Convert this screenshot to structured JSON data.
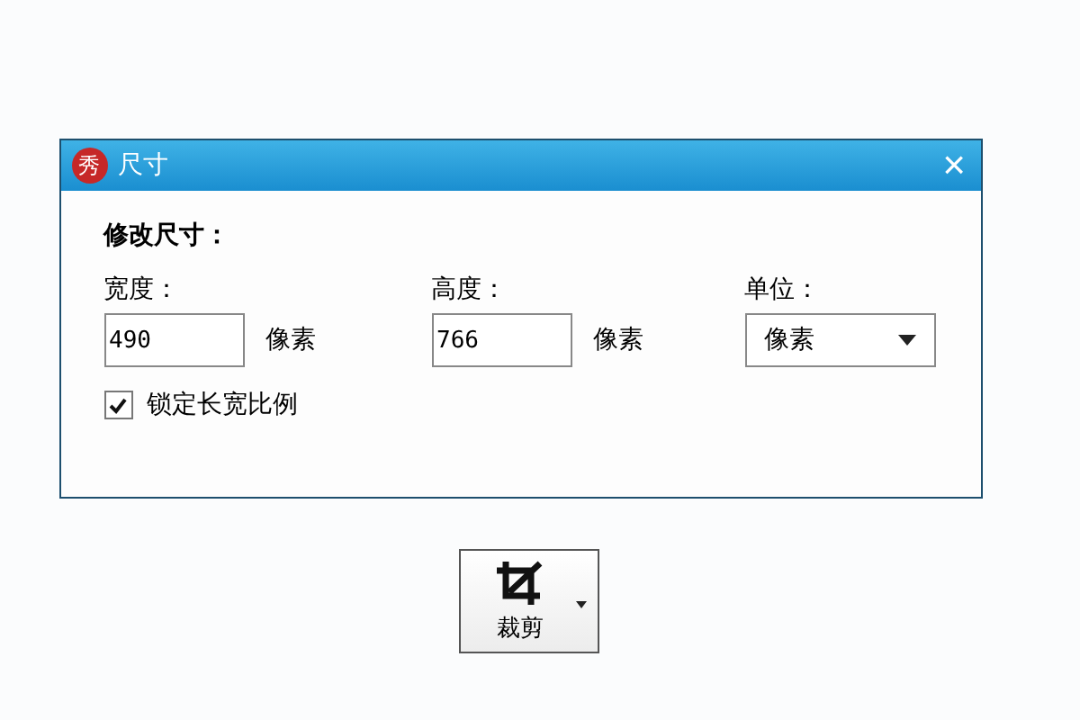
{
  "dialog": {
    "logo": "秀",
    "title": "尺寸",
    "close": "×",
    "heading": "修改尺寸：",
    "fields": [
      {
        "kind": "number",
        "label": "宽度：",
        "value": "490",
        "unit": "像素"
      },
      {
        "kind": "number",
        "label": "高度：",
        "value": "766",
        "unit": "像素"
      },
      {
        "kind": "select",
        "label": "单位：",
        "value": "像素"
      }
    ],
    "lock": {
      "label": "锁定长宽比例",
      "checked": true
    }
  },
  "crop_button": {
    "label": "裁剪"
  }
}
